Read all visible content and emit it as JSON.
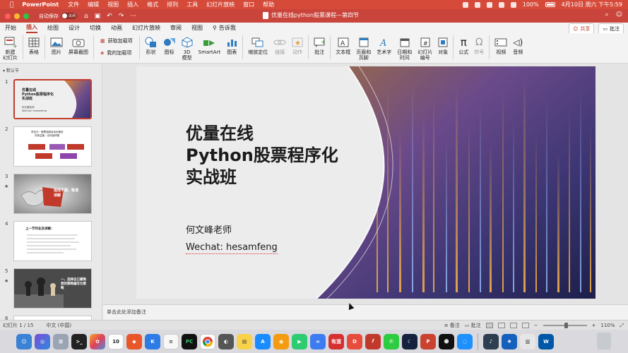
{
  "menubar": {
    "app_name": "PowerPoint",
    "items": [
      "文件",
      "编辑",
      "视图",
      "插入",
      "格式",
      "排列",
      "工具",
      "幻灯片放映",
      "窗口",
      "帮助"
    ],
    "battery": "100%",
    "datetime": "4月10日 周六 下午5:59"
  },
  "titlebar": {
    "autosave_label": "自动保存",
    "autosave_state": "关闭",
    "doc_title": "优量在线python股票课程—第四节"
  },
  "tabs": {
    "items": [
      "开始",
      "插入",
      "绘图",
      "设计",
      "切换",
      "动画",
      "幻灯片放映",
      "审阅",
      "视图"
    ],
    "active": "插入",
    "tell_me": "告诉我",
    "share": "共享",
    "comments": "批注"
  },
  "ribbon": {
    "new_slide": "新建\n幻灯片",
    "table": "表格",
    "pictures": "图片",
    "screenshot": "屏幕截图",
    "get_addins": "获取加载项",
    "my_addins": "我的加载项",
    "shapes": "形状",
    "icons": "图标",
    "models_3d": "3D\n模型",
    "smartart": "SmartArt",
    "chart": "图表",
    "zoom": "缩放定位",
    "link": "链接",
    "action": "动作",
    "comment": "批注",
    "textbox": "文本框",
    "header_footer": "页眉和\n页脚",
    "wordart": "艺术字",
    "date_time": "日期和\n时间",
    "slide_number": "幻灯片\n编号",
    "object": "对象",
    "equation": "公式",
    "symbol": "符号",
    "video": "视频",
    "audio": "音频"
  },
  "sidebar": {
    "section_label": "默认节",
    "slides": [
      {
        "num": "1",
        "star": "",
        "title": "优量在线\nPython股票程序化\n实战班",
        "sub": "何文峰老师\nWechat: hesamfeng"
      },
      {
        "num": "2",
        "star": "",
        "title": "项目方：股票选股自动化程序\n的收益能：自动投研报",
        "sub": ""
      },
      {
        "num": "3",
        "star": "★",
        "title": "造成不便，敬请\n谅解",
        "sub": ""
      },
      {
        "num": "4",
        "star": "",
        "title": "上一节作业及讲解：",
        "sub": ""
      },
      {
        "num": "5",
        "star": "★",
        "title": "一、选择自己最熟\n悉的策略编写为策\n略",
        "sub": ""
      },
      {
        "num": "6",
        "star": "",
        "title": "",
        "sub": ""
      }
    ]
  },
  "slide": {
    "title": "优量在线\nPython股票程序化\n实战班",
    "author": "何文峰老师",
    "wechat": "Wechat: hesamfeng"
  },
  "notes": {
    "placeholder": "单击此处添加备注"
  },
  "status": {
    "slide_count": "幻灯片 1 / 15",
    "language": "中文 (中国)",
    "notes_btn": "备注",
    "comments_btn": "批注",
    "zoom_level": "110%"
  },
  "dock": {
    "calendar_day": "10",
    "apps": [
      "Finder",
      "Siri",
      "Launchpad",
      "Terminal",
      "Photos",
      "Sketch",
      "Kite",
      "Notes",
      "PyCharm",
      "Chrome",
      "Safari",
      "Stickies",
      "Script",
      "App Store",
      "Office",
      "Maps",
      "Baidu",
      "Youdao",
      "Dict",
      "Parallels",
      "WeChat",
      "Moon",
      "PowerPoint",
      "QQ",
      "Browser",
      "Music",
      "Photos2",
      "Pages",
      "Scanner",
      "Word"
    ]
  }
}
